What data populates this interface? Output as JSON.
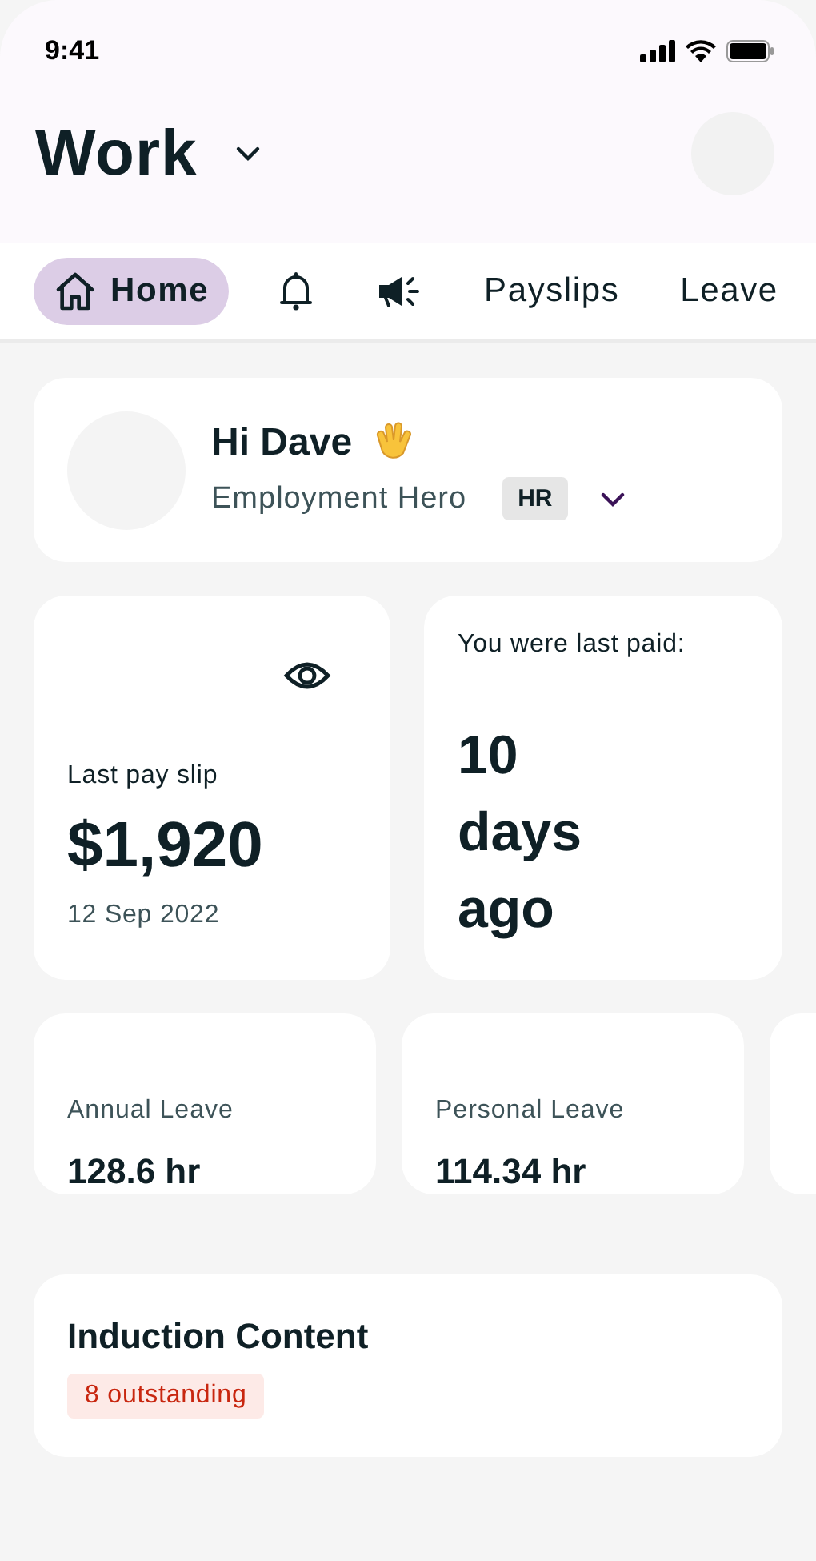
{
  "status_bar": {
    "time": "9:41"
  },
  "header": {
    "title": "Work"
  },
  "tabs": [
    {
      "kind": "icon-label",
      "label": "Home",
      "selected": true
    },
    {
      "kind": "bell",
      "selected": false
    },
    {
      "kind": "megaphone",
      "selected": false
    },
    {
      "kind": "label",
      "label": "Payslips",
      "selected": false
    },
    {
      "kind": "label",
      "label": "Leave",
      "selected": false
    }
  ],
  "greeting": {
    "title": "Hi Dave",
    "company": "Employment Hero",
    "badge": "HR"
  },
  "last_payslip": {
    "label": "Last pay slip",
    "amount": "$1,920",
    "date": "12 Sep 2022"
  },
  "last_paid": {
    "label": "You were last paid:",
    "value": "10 days ago"
  },
  "leave_balances": [
    {
      "kind": "card",
      "name": "Annual Leave",
      "value": "128.6 hr"
    },
    {
      "kind": "card",
      "name": "Personal Leave",
      "value": "114.34 hr"
    },
    {
      "kind": "cut"
    }
  ],
  "induction": {
    "title": "Induction Content",
    "badge": "8 outstanding"
  }
}
